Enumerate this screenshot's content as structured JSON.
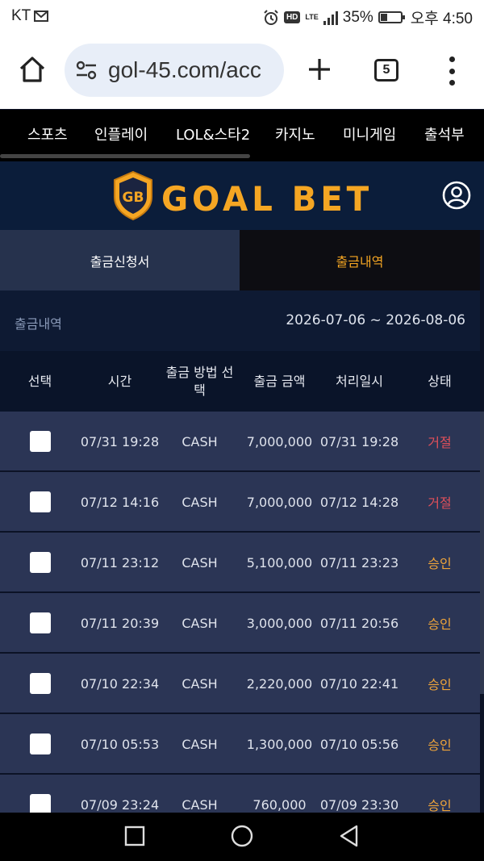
{
  "status_bar": {
    "carrier": "KT",
    "battery_text": "35%",
    "battery_level": 0.35,
    "time": "오후 4:50",
    "hd_label": "HD",
    "network_label": "LTE"
  },
  "browser": {
    "url": "gol-45.com/acc",
    "tab_count": "5"
  },
  "nav": {
    "items": [
      "스포츠",
      "인플레이",
      "LOL&스타2",
      "카지노",
      "미니게임",
      "출석부"
    ]
  },
  "brand": {
    "logo_text": "GOAL BET",
    "badge_text": "GB",
    "accent": "#f5a623"
  },
  "tabs": {
    "request_label": "출금신청서",
    "history_label": "출금내역"
  },
  "history": {
    "label": "출금내역",
    "date_range": "2026-07-06 ~ 2026-08-06"
  },
  "table": {
    "headers": [
      "선택",
      "시간",
      "출금 방법 선택",
      "출금 금액",
      "처리일시",
      "상태"
    ],
    "rows": [
      {
        "time": "07/31 19:28",
        "method": "CASH",
        "amount": "7,000,000",
        "processed": "07/31 19:28",
        "status": "거절",
        "status_type": "rejected"
      },
      {
        "time": "07/12 14:16",
        "method": "CASH",
        "amount": "7,000,000",
        "processed": "07/12 14:28",
        "status": "거절",
        "status_type": "rejected"
      },
      {
        "time": "07/11 23:12",
        "method": "CASH",
        "amount": "5,100,000",
        "processed": "07/11 23:23",
        "status": "승인",
        "status_type": "approved"
      },
      {
        "time": "07/11 20:39",
        "method": "CASH",
        "amount": "3,000,000",
        "processed": "07/11 20:56",
        "status": "승인",
        "status_type": "approved"
      },
      {
        "time": "07/10 22:34",
        "method": "CASH",
        "amount": "2,220,000",
        "processed": "07/10 22:41",
        "status": "승인",
        "status_type": "approved"
      },
      {
        "time": "07/10 05:53",
        "method": "CASH",
        "amount": "1,300,000",
        "processed": "07/10 05:56",
        "status": "승인",
        "status_type": "approved"
      },
      {
        "time": "07/09 23:24",
        "method": "CASH",
        "amount": "760,000",
        "processed": "07/09 23:30",
        "status": "승인",
        "status_type": "approved"
      }
    ]
  },
  "colors": {
    "rejected": "#e0505a",
    "approved": "#f0a53a"
  }
}
